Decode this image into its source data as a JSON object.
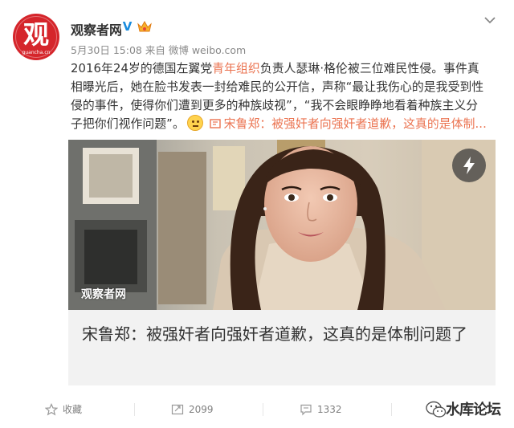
{
  "post": {
    "avatar_char": "观",
    "avatar_small_text": "guancha.cn",
    "username": "观察者网",
    "verified_mark": "V",
    "date": "5月30日 15:08",
    "source_prefix": "来自",
    "source": "微博 weibo.com",
    "text_1": "2016年24岁的德国左翼党",
    "text_highlight": "青年组织",
    "text_2": "负责人瑟琳·格伦被三位难民性侵。事件真相曝光后，她在脸书发表一封给难民的公开信，声称“最让我伤心的是我受到性侵的事件，使得你们遭到更多的种族歧视”，“我不会眼睁睁地看着种族主义分子把你们视作问题”。",
    "link_text": "宋鲁郑：被强奸者向强奸者道歉，这真的是体制..."
  },
  "media": {
    "watermark": "观察者网",
    "article_title": "宋鲁郑：被强奸者向强奸者道歉，这真的是体制问题了"
  },
  "actions": {
    "favorite_label": "收藏",
    "repost_count": "2099",
    "comment_count": "1332"
  },
  "forum_watermark": "水库论坛",
  "colors": {
    "link": "#eb7350",
    "verified": "#1a8cde",
    "avatar_bg": "#d5252b"
  }
}
